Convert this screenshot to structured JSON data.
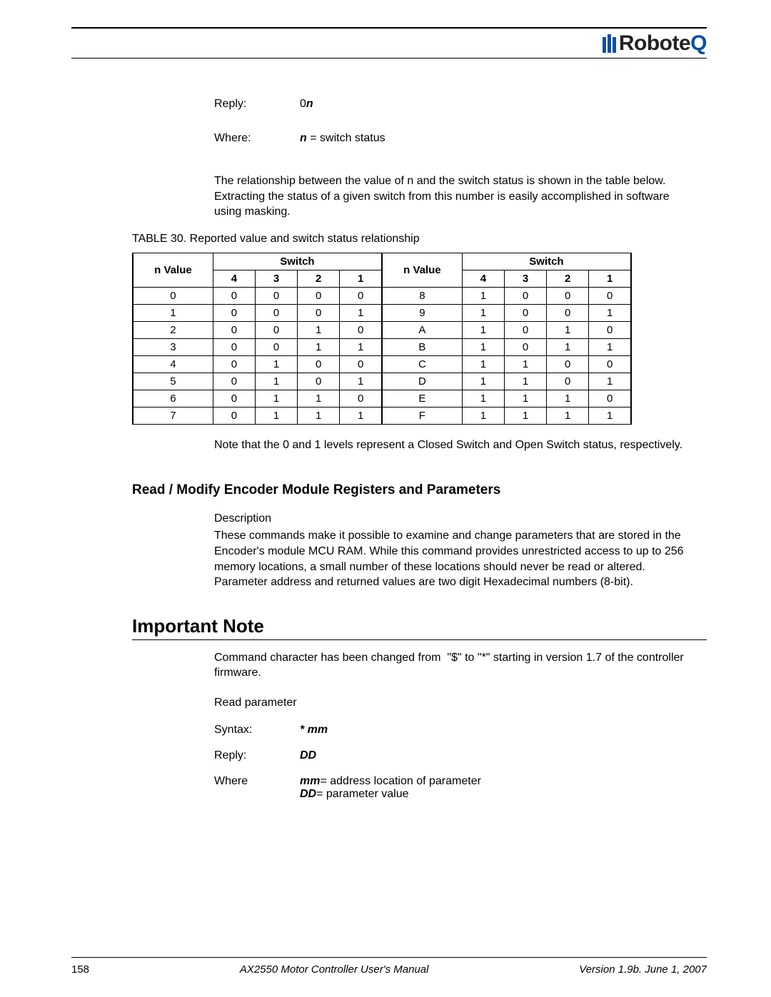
{
  "logo": {
    "name_prefix": "Robote",
    "name_accent": "Q"
  },
  "defs": {
    "reply_label": "Reply:",
    "reply_value_prefix": "0",
    "reply_value_var": "n",
    "where_label": "Where:",
    "where_var": "n",
    "where_rest": " = switch status"
  },
  "relationship_para": "The relationship between the value of n and the switch status is shown in the table below. Extracting the status of a given switch from this number is easily accomplished in software using masking.",
  "table_caption": "TABLE 30. Reported value and switch status relationship",
  "table_headers": {
    "n_value": "n Value",
    "switch": "Switch",
    "cols": [
      "4",
      "3",
      "2",
      "1"
    ]
  },
  "chart_data": {
    "type": "table",
    "title": "Reported value and switch status relationship",
    "columns_left": [
      "n Value",
      "Switch 4",
      "Switch 3",
      "Switch 2",
      "Switch 1"
    ],
    "columns_right": [
      "n Value",
      "Switch 4",
      "Switch 3",
      "Switch 2",
      "Switch 1"
    ],
    "rows": [
      {
        "left": [
          "0",
          "0",
          "0",
          "0",
          "0"
        ],
        "right": [
          "8",
          "1",
          "0",
          "0",
          "0"
        ]
      },
      {
        "left": [
          "1",
          "0",
          "0",
          "0",
          "1"
        ],
        "right": [
          "9",
          "1",
          "0",
          "0",
          "1"
        ]
      },
      {
        "left": [
          "2",
          "0",
          "0",
          "1",
          "0"
        ],
        "right": [
          "A",
          "1",
          "0",
          "1",
          "0"
        ]
      },
      {
        "left": [
          "3",
          "0",
          "0",
          "1",
          "1"
        ],
        "right": [
          "B",
          "1",
          "0",
          "1",
          "1"
        ]
      },
      {
        "left": [
          "4",
          "0",
          "1",
          "0",
          "0"
        ],
        "right": [
          "C",
          "1",
          "1",
          "0",
          "0"
        ]
      },
      {
        "left": [
          "5",
          "0",
          "1",
          "0",
          "1"
        ],
        "right": [
          "D",
          "1",
          "1",
          "0",
          "1"
        ]
      },
      {
        "left": [
          "6",
          "0",
          "1",
          "1",
          "0"
        ],
        "right": [
          "E",
          "1",
          "1",
          "1",
          "0"
        ]
      },
      {
        "left": [
          "7",
          "0",
          "1",
          "1",
          "1"
        ],
        "right": [
          "F",
          "1",
          "1",
          "1",
          "1"
        ]
      }
    ]
  },
  "note_para": "Note that the 0 and 1 levels represent a Closed Switch and Open Switch status, respectively.",
  "section_heading": "Read / Modify Encoder Module Registers and Parameters",
  "description_label": "Description",
  "description_text": "These commands make it possible to examine and change parameters that are stored in the Encoder's module MCU RAM. While this command provides unrestricted access to up to 256 memory locations, a small number of these locations should never be read or altered. Parameter address and returned values are two digit Hexadecimal numbers (8-bit).",
  "important_note_heading": "Important Note",
  "important_note_text_1": "Command character has been changed from ",
  "important_note_quote": " \"$\" to \"*\" ",
  "important_note_text_2": "starting in version 1.7 of the controller firmware.",
  "read_param_label": "Read parameter",
  "syntax": {
    "label": "Syntax:",
    "value": "* mm"
  },
  "reply2": {
    "label": "Reply:",
    "value": "DD"
  },
  "where2": {
    "label": "Where",
    "mm_var": "mm",
    "mm_rest": "= address location of parameter",
    "dd_var": "DD",
    "dd_rest": "= parameter value"
  },
  "footer": {
    "page": "158",
    "title": "AX2550 Motor Controller User's Manual",
    "version": "Version 1.9b. June 1, 2007"
  }
}
